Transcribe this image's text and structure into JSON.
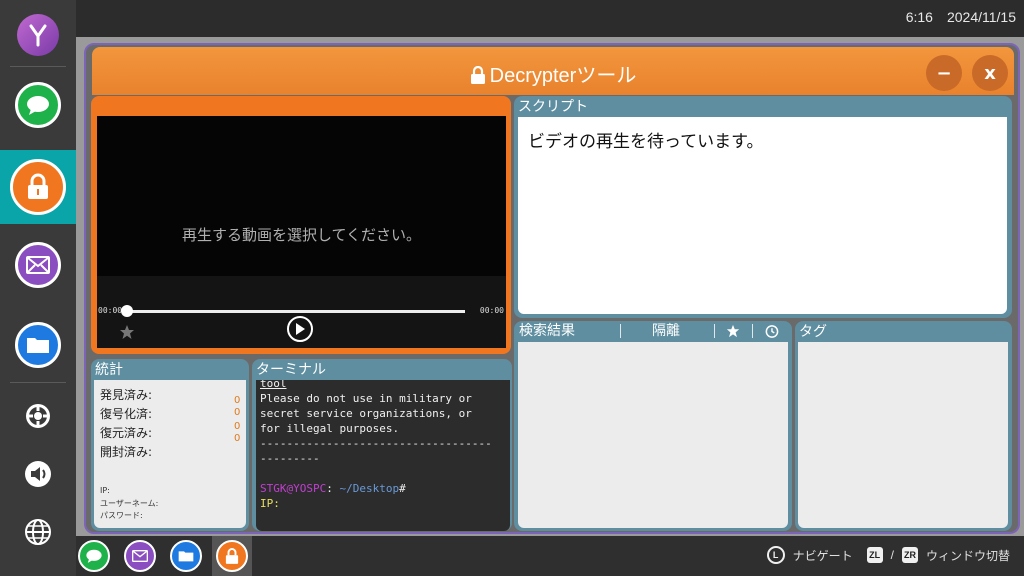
{
  "status_bar": {
    "time": "6:16",
    "date": "2024/11/15"
  },
  "window": {
    "title": "Decrypterツール",
    "minimize_label": "−",
    "close_label": "x"
  },
  "video": {
    "message": "再生する動画を選択してください。",
    "time_start": "00:00",
    "time_end": "00:00",
    "progress": 0
  },
  "script": {
    "header": "スクリプト",
    "text": "ビデオの再生を待っています。"
  },
  "stats": {
    "header": "統計",
    "rows": [
      {
        "label": "発見済み:",
        "value": ""
      },
      {
        "label": "復号化済:",
        "value": "0"
      },
      {
        "label": "復元済み:",
        "value": "0"
      },
      {
        "label": "開封済み:",
        "value": "0"
      }
    ],
    "extra_values": [
      "0"
    ],
    "ip_label": "IP:",
    "user_label": "ユーザーネーム:",
    "password_label": "パスワード:"
  },
  "terminal": {
    "header": "ターミナル",
    "lines": [
      "tool",
      "Please do not use in military or",
      "secret service organizations, or",
      "for illegal purposes.",
      "-----------------------------------",
      "---------"
    ],
    "prompt_user": "STGK@YOSPC",
    "prompt_colon": ":",
    "prompt_path": " ~/Desktop",
    "prompt_hash": "#",
    "ip_line": "IP:"
  },
  "results": {
    "header": "検索結果",
    "quarantine_label": "隔離"
  },
  "tags": {
    "header": "タグ"
  },
  "taskbar": {
    "navigate_label": "ナビゲート",
    "zl": "ZL",
    "slash": "/",
    "zr": "ZR",
    "switch_label": "ウィンドウ切替",
    "l_button": "L"
  },
  "colors": {
    "accent_orange": "#f0761f",
    "panel_blue": "#5e8ea0",
    "teal_active": "#0aa5a8"
  }
}
